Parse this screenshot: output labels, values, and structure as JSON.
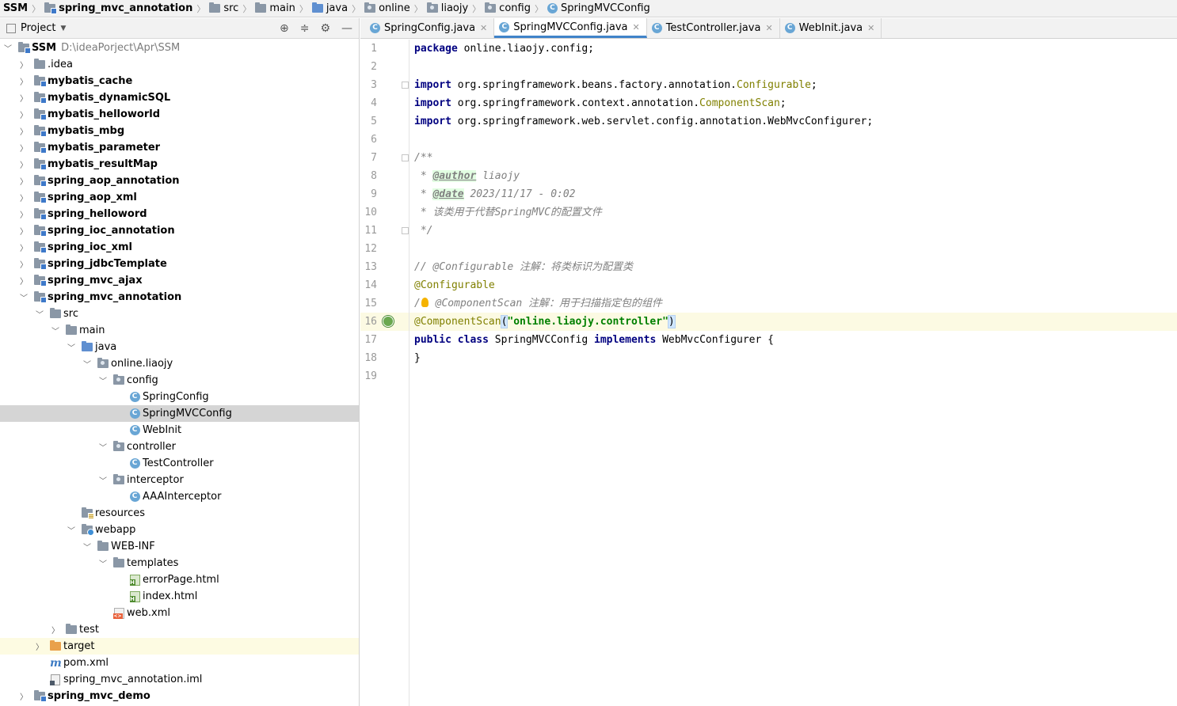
{
  "breadcrumb": [
    "SSM",
    "spring_mvc_annotation",
    "src",
    "main",
    "java",
    "online",
    "liaojy",
    "config",
    "SpringMVCConfig"
  ],
  "project_panel": {
    "title": "Project",
    "tree": [
      {
        "label": "SSM",
        "path": "D:\\ideaPorject\\Apr\\SSM",
        "depth": 0,
        "state": "expanded",
        "icon": "module-folder-icon",
        "bold": true
      },
      {
        "label": ".idea",
        "depth": 1,
        "state": "collapsed",
        "icon": "folder-icon"
      },
      {
        "label": "mybatis_cache",
        "depth": 1,
        "state": "collapsed",
        "icon": "module-folder-icon",
        "bold": true
      },
      {
        "label": "mybatis_dynamicSQL",
        "depth": 1,
        "state": "collapsed",
        "icon": "module-folder-icon",
        "bold": true
      },
      {
        "label": "mybatis_helloworld",
        "depth": 1,
        "state": "collapsed",
        "icon": "module-folder-icon",
        "bold": true
      },
      {
        "label": "mybatis_mbg",
        "depth": 1,
        "state": "collapsed",
        "icon": "module-folder-icon",
        "bold": true
      },
      {
        "label": "mybatis_parameter",
        "depth": 1,
        "state": "collapsed",
        "icon": "module-folder-icon",
        "bold": true
      },
      {
        "label": "mybatis_resultMap",
        "depth": 1,
        "state": "collapsed",
        "icon": "module-folder-icon",
        "bold": true
      },
      {
        "label": "spring_aop_annotation",
        "depth": 1,
        "state": "collapsed",
        "icon": "module-folder-icon",
        "bold": true
      },
      {
        "label": "spring_aop_xml",
        "depth": 1,
        "state": "collapsed",
        "icon": "module-folder-icon",
        "bold": true
      },
      {
        "label": "spring_helloword",
        "depth": 1,
        "state": "collapsed",
        "icon": "module-folder-icon",
        "bold": true
      },
      {
        "label": "spring_ioc_annotation",
        "depth": 1,
        "state": "collapsed",
        "icon": "module-folder-icon",
        "bold": true
      },
      {
        "label": "spring_ioc_xml",
        "depth": 1,
        "state": "collapsed",
        "icon": "module-folder-icon",
        "bold": true
      },
      {
        "label": "spring_jdbcTemplate",
        "depth": 1,
        "state": "collapsed",
        "icon": "module-folder-icon",
        "bold": true
      },
      {
        "label": "spring_mvc_ajax",
        "depth": 1,
        "state": "collapsed",
        "icon": "module-folder-icon",
        "bold": true
      },
      {
        "label": "spring_mvc_annotation",
        "depth": 1,
        "state": "expanded",
        "icon": "module-folder-icon",
        "bold": true
      },
      {
        "label": "src",
        "depth": 2,
        "state": "expanded",
        "icon": "folder-icon"
      },
      {
        "label": "main",
        "depth": 3,
        "state": "expanded",
        "icon": "folder-icon"
      },
      {
        "label": "java",
        "depth": 4,
        "state": "expanded",
        "icon": "source-folder-icon"
      },
      {
        "label": "online.liaojy",
        "depth": 5,
        "state": "expanded",
        "icon": "package-icon"
      },
      {
        "label": "config",
        "depth": 6,
        "state": "expanded",
        "icon": "package-icon"
      },
      {
        "label": "SpringConfig",
        "depth": 7,
        "state": "leaf",
        "icon": "class-icon"
      },
      {
        "label": "SpringMVCConfig",
        "depth": 7,
        "state": "leaf",
        "icon": "class-icon",
        "selected": true
      },
      {
        "label": "WebInit",
        "depth": 7,
        "state": "leaf",
        "icon": "class-icon"
      },
      {
        "label": "controller",
        "depth": 6,
        "state": "expanded",
        "icon": "package-icon"
      },
      {
        "label": "TestController",
        "depth": 7,
        "state": "leaf",
        "icon": "class-icon"
      },
      {
        "label": "interceptor",
        "depth": 6,
        "state": "expanded",
        "icon": "package-icon"
      },
      {
        "label": "AAAInterceptor",
        "depth": 7,
        "state": "leaf",
        "icon": "class-icon"
      },
      {
        "label": "resources",
        "depth": 4,
        "state": "leaf",
        "icon": "resources-folder-icon"
      },
      {
        "label": "webapp",
        "depth": 4,
        "state": "expanded",
        "icon": "web-folder-icon"
      },
      {
        "label": "WEB-INF",
        "depth": 5,
        "state": "expanded",
        "icon": "folder-icon"
      },
      {
        "label": "templates",
        "depth": 6,
        "state": "expanded",
        "icon": "folder-icon"
      },
      {
        "label": "errorPage.html",
        "depth": 7,
        "state": "leaf",
        "icon": "html-file-icon"
      },
      {
        "label": "index.html",
        "depth": 7,
        "state": "leaf",
        "icon": "html-file-icon"
      },
      {
        "label": "web.xml",
        "depth": 6,
        "state": "leaf",
        "icon": "xml-file-icon"
      },
      {
        "label": "test",
        "depth": 3,
        "state": "collapsed",
        "icon": "folder-icon"
      },
      {
        "label": "target",
        "depth": 2,
        "state": "collapsed",
        "icon": "excluded-folder-icon",
        "highlight": true
      },
      {
        "label": "pom.xml",
        "depth": 2,
        "state": "leaf",
        "icon": "maven-icon"
      },
      {
        "label": "spring_mvc_annotation.iml",
        "depth": 2,
        "state": "leaf",
        "icon": "iml-file-icon"
      },
      {
        "label": "spring_mvc_demo",
        "depth": 1,
        "state": "collapsed",
        "icon": "module-folder-icon",
        "bold": true
      }
    ]
  },
  "editor": {
    "tabs": [
      {
        "label": "SpringConfig.java",
        "active": false
      },
      {
        "label": "SpringMVCConfig.java",
        "active": true
      },
      {
        "label": "TestController.java",
        "active": false
      },
      {
        "label": "WebInit.java",
        "active": false
      }
    ],
    "current_line": 16,
    "lines": [
      [
        {
          "t": "package",
          "c": "kw"
        },
        {
          "t": " online.liaojy.config;"
        }
      ],
      [],
      [
        {
          "t": "import",
          "c": "kw"
        },
        {
          "t": " org.springframework.beans.factory.annotation."
        },
        {
          "t": "Configurable",
          "c": "ann"
        },
        {
          "t": ";"
        }
      ],
      [
        {
          "t": "import",
          "c": "kw"
        },
        {
          "t": " org.springframework.context.annotation."
        },
        {
          "t": "ComponentScan",
          "c": "ann"
        },
        {
          "t": ";"
        }
      ],
      [
        {
          "t": "import",
          "c": "kw"
        },
        {
          "t": " org.springframework.web.servlet.config.annotation.WebMvcConfigurer;"
        }
      ],
      [],
      [
        {
          "t": "/**",
          "c": "cm"
        }
      ],
      [
        {
          "t": " * ",
          "c": "cm"
        },
        {
          "t": "@author",
          "c": "doctag"
        },
        {
          "t": " liaojy",
          "c": "cm"
        }
      ],
      [
        {
          "t": " * ",
          "c": "cm"
        },
        {
          "t": "@date",
          "c": "doctag"
        },
        {
          "t": " 2023/11/17 - 0:02",
          "c": "cm"
        }
      ],
      [
        {
          "t": " * 该类用于代替SpringMVC的配置文件",
          "c": "cm"
        }
      ],
      [
        {
          "t": " */",
          "c": "cm"
        }
      ],
      [],
      [
        {
          "t": "// @Configurable 注解：将类标识为配置类",
          "c": "cm"
        }
      ],
      [
        {
          "t": "@Configurable",
          "c": "ann"
        }
      ],
      [
        {
          "t": "/",
          "c": "cm"
        },
        {
          "t": "",
          "c": "bulb"
        },
        {
          "t": " @ComponentScan 注解：用于扫描指定包的组件",
          "c": "cm"
        }
      ],
      [
        {
          "t": "@ComponentScan",
          "c": "ann"
        },
        {
          "t": "(",
          "c": "brace"
        },
        {
          "t": "\"online.liaojy.controller\"",
          "c": "str"
        },
        {
          "t": ")",
          "c": "brace"
        }
      ],
      [
        {
          "t": "public",
          "c": "kw"
        },
        {
          "t": " "
        },
        {
          "t": "class",
          "c": "kw"
        },
        {
          "t": " SpringMVCConfig "
        },
        {
          "t": "implements",
          "c": "kw"
        },
        {
          "t": " WebMvcConfigurer {"
        }
      ],
      [
        {
          "t": "}"
        }
      ],
      []
    ]
  }
}
